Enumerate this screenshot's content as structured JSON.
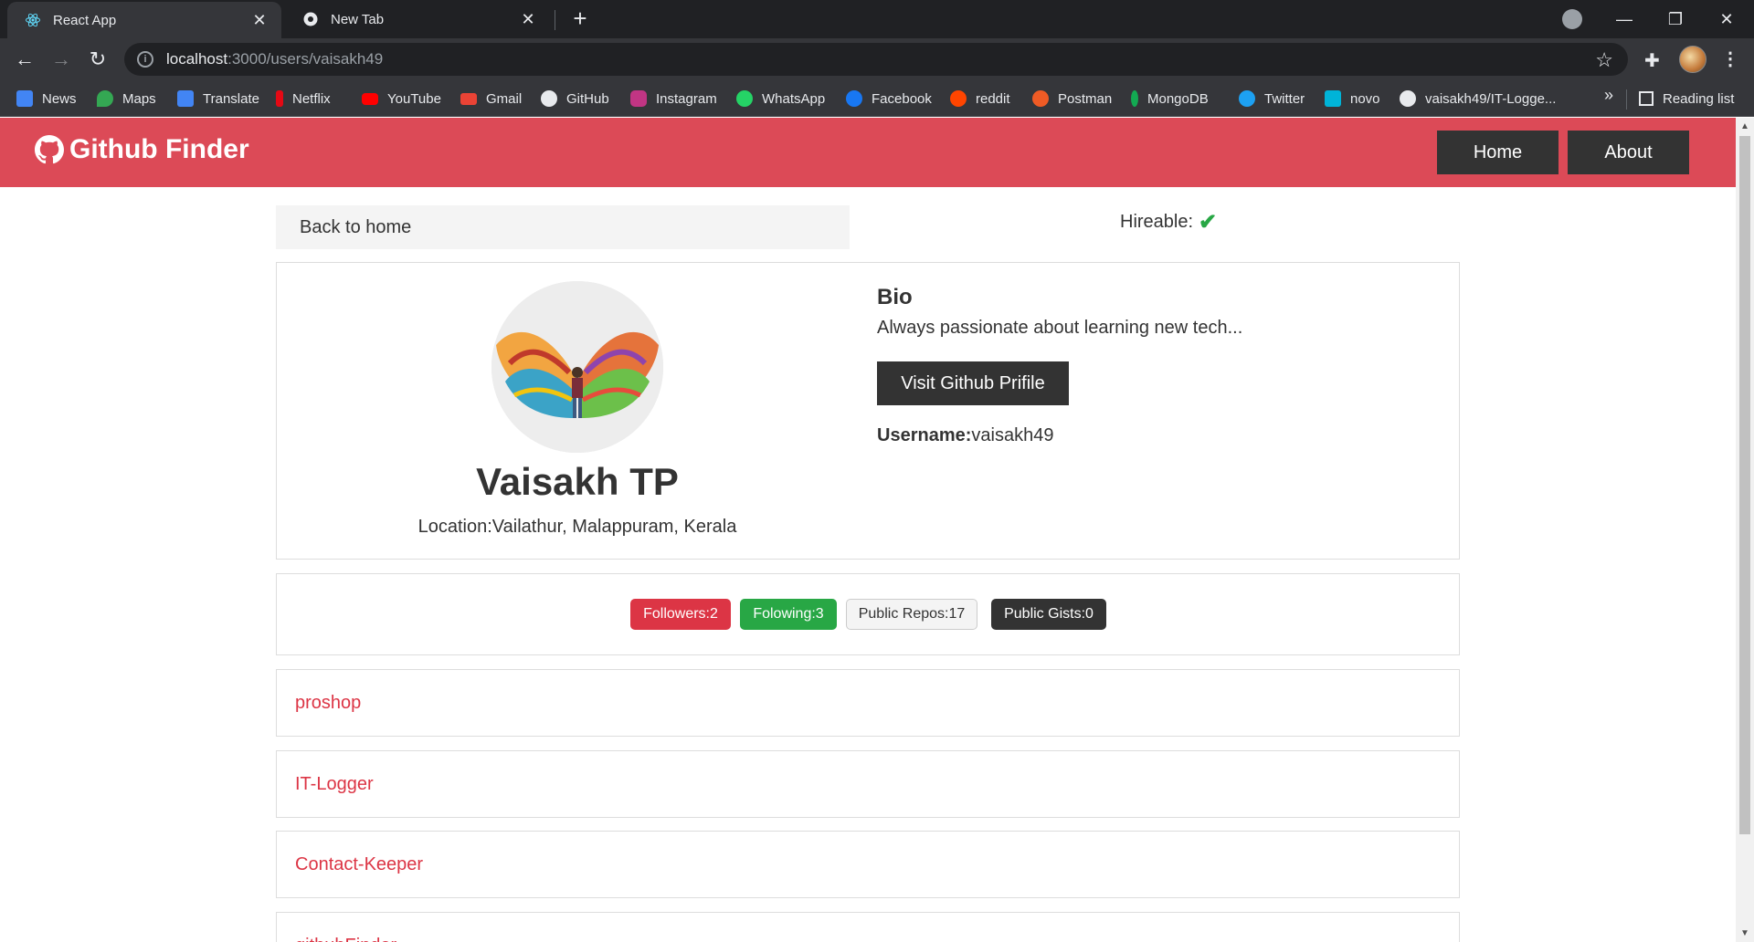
{
  "browser": {
    "tabs": [
      {
        "title": "React App",
        "active": true
      },
      {
        "title": "New Tab",
        "active": false
      }
    ],
    "url_host": "localhost",
    "url_path": ":3000/users/vaisakh49",
    "bookmarks": [
      {
        "label": "News",
        "color": "#4285f4"
      },
      {
        "label": "Maps",
        "color": "#34a853"
      },
      {
        "label": "Translate",
        "color": "#4285f4"
      },
      {
        "label": "Netflix",
        "color": "#e50914"
      },
      {
        "label": "YouTube",
        "color": "#ff0000"
      },
      {
        "label": "Gmail",
        "color": "#ea4335"
      },
      {
        "label": "GitHub",
        "color": "#ffffff"
      },
      {
        "label": "Instagram",
        "color": "#c13584"
      },
      {
        "label": "WhatsApp",
        "color": "#25d366"
      },
      {
        "label": "Facebook",
        "color": "#1877f2"
      },
      {
        "label": "reddit",
        "color": "#ff4500"
      },
      {
        "label": "Postman",
        "color": "#ef5b25"
      },
      {
        "label": "MongoDB",
        "color": "#13aa52"
      },
      {
        "label": "Twitter",
        "color": "#1da1f2"
      },
      {
        "label": "novo",
        "color": "#00b4d8"
      },
      {
        "label": "vaisakh49/IT-Logge...",
        "color": "#ffffff"
      }
    ],
    "more_label": "»",
    "reading_list_label": "Reading list"
  },
  "app": {
    "brand": "Github Finder",
    "nav": {
      "home": "Home",
      "about": "About"
    },
    "back_label": "Back to home",
    "hireable_label": "Hireable:",
    "user": {
      "name": "Vaisakh TP",
      "location": "Location:Vailathur, Malappuram, Kerala",
      "bio_title": "Bio",
      "bio": "Always passionate about learning new tech...",
      "visit_label": "Visit Github Prifile",
      "username_label": "Username:",
      "username": "vaisakh49"
    },
    "stats": {
      "followers": "Followers:2",
      "following": "Folowing:3",
      "repos": "Public Repos:17",
      "gists": "Public Gists:0"
    },
    "repos": [
      "proshop",
      "IT-Logger",
      "Contact-Keeper",
      "githubFinder"
    ],
    "colors": {
      "navbar": "#dc4a57",
      "danger": "#dc3545",
      "success": "#28a745",
      "dark": "#333333"
    }
  }
}
